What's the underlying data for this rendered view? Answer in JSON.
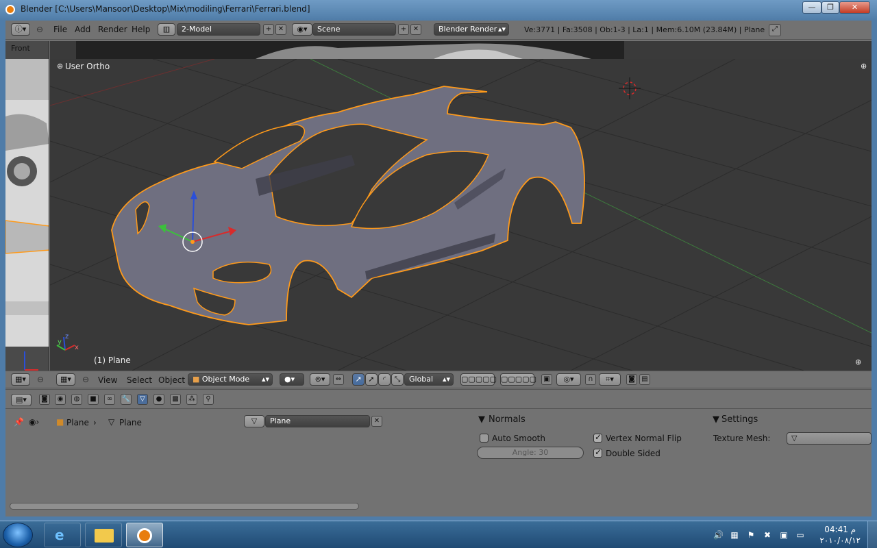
{
  "window": {
    "title": "Blender [C:\\Users\\Mansoor\\Desktop\\Mix\\modiling\\Ferrari\\Ferrari.blend]",
    "controls": [
      "—",
      "❐",
      "✕"
    ]
  },
  "info_header": {
    "menus": [
      "File",
      "Add",
      "Render",
      "Help"
    ],
    "screen_layout": "2-Model",
    "scene": "Scene",
    "render_engine": "Blender Render",
    "stats": "Ve:3771 | Fa:3508 | Ob:1-3 | La:1 | Mem:6.10M (23.84M) | Plane"
  },
  "side_view": {
    "label": "Front"
  },
  "viewport": {
    "view_label": "User Ortho",
    "object_label": "(1) Plane",
    "axis_x": "x",
    "axis_y": "y",
    "axis_z": "z"
  },
  "view3d_header": {
    "menus": [
      "View",
      "Select",
      "Object"
    ],
    "mode": "Object Mode",
    "orientation": "Global"
  },
  "properties": {
    "breadcrumb_object": "Plane",
    "breadcrumb_mesh": "Plane",
    "datablock_name": "Plane",
    "normals_panel": {
      "title": "Normals",
      "auto_smooth": "Auto Smooth",
      "auto_smooth_checked": false,
      "angle": "Angle: 30",
      "vertex_normal_flip": "Vertex Normal Flip",
      "vertex_normal_flip_checked": true,
      "double_sided": "Double Sided",
      "double_sided_checked": true
    },
    "settings_panel": {
      "title": "Settings",
      "texture_mesh_label": "Texture Mesh:"
    }
  },
  "taskbar": {
    "clock_time": "04:41 م",
    "clock_date": "٢٠١٠/٠٨/١٢"
  },
  "colors": {
    "accent": "#e87d0d",
    "viewport_bg": "#393939",
    "ui_bg": "#727272",
    "selection_outline": "#ff9a1a"
  }
}
